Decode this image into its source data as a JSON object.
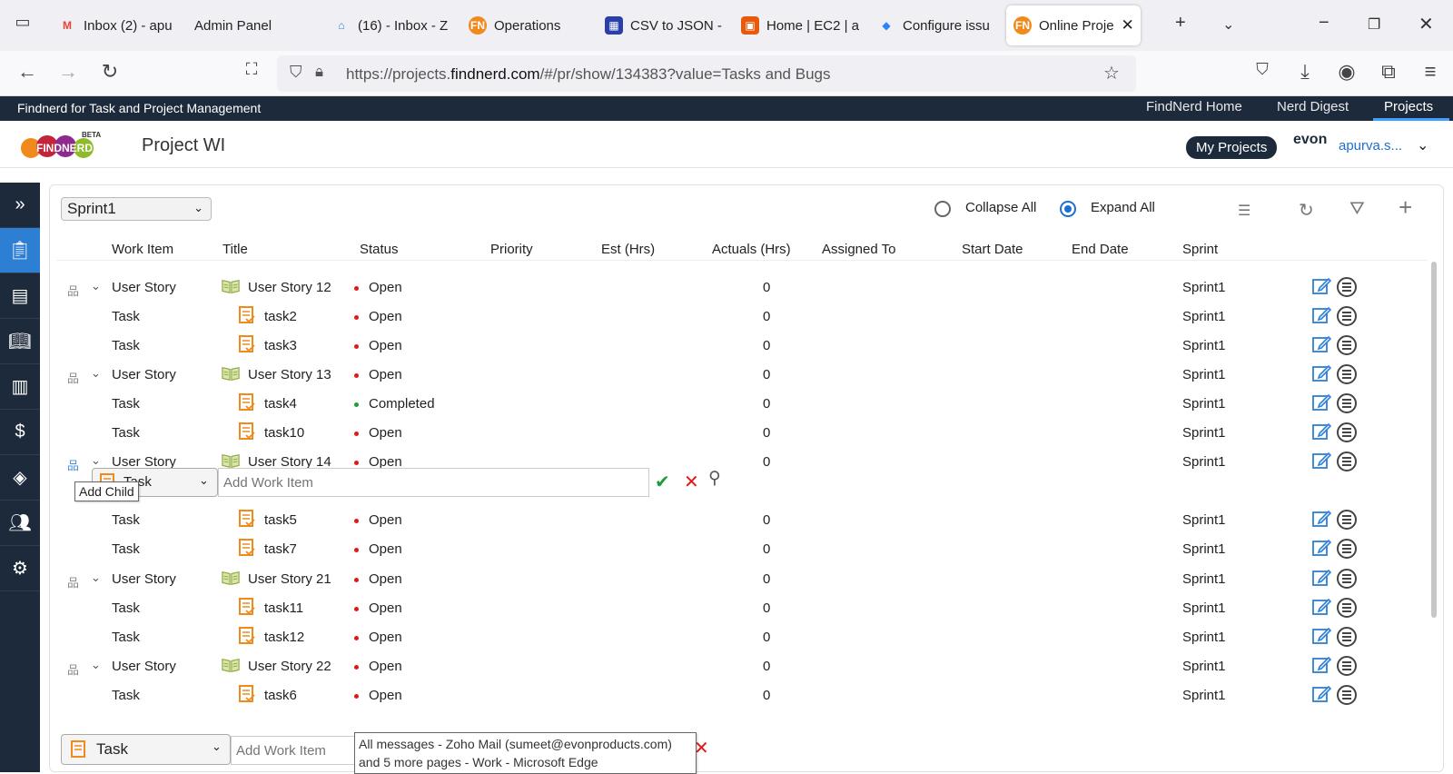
{
  "browser": {
    "tabs": [
      {
        "label": "Inbox (2) - apu",
        "icon": "gmail-icon"
      },
      {
        "label": "Admin Panel",
        "icon": "none"
      },
      {
        "label": "(16) - Inbox - Z",
        "icon": "zoho-icon"
      },
      {
        "label": "Operations",
        "icon": "fn-icon"
      },
      {
        "label": "CSV to JSON -",
        "icon": "csv-icon"
      },
      {
        "label": "Home | EC2 | a",
        "icon": "aws-icon"
      },
      {
        "label": "Configure issu",
        "icon": "jira-icon"
      },
      {
        "label": "Online Proje",
        "icon": "fn-icon",
        "active": true
      }
    ],
    "url_prefix": "https://projects.",
    "url_domain": "findnerd.com",
    "url_suffix": "/#/pr/show/134383?value=Tasks and Bugs"
  },
  "app": {
    "title": "Findnerd for Task and Project Management",
    "nav": [
      "FindNerd Home",
      "Nerd Digest",
      "Projects"
    ],
    "logo_text": "FINDNERD",
    "logo_badge": "BETA",
    "project_title": "Project WI",
    "my_projects": "My Projects",
    "brand": "evon",
    "username": "apurva.s..."
  },
  "toolbar": {
    "sprint": "Sprint1",
    "collapse_all": "Collapse All",
    "expand_all": "Expand All",
    "view_mode": "Expand All"
  },
  "columns": [
    "Work Item",
    "Title",
    "Status",
    "Priority",
    "Est (Hrs)",
    "Actuals (Hrs)",
    "Assigned To",
    "Start Date",
    "End Date",
    "Sprint"
  ],
  "rows": [
    {
      "type": "User Story",
      "title": "User Story 12",
      "status": "Open",
      "actuals": "0",
      "sprint": "Sprint1"
    },
    {
      "type": "Task",
      "title": "task2",
      "status": "Open",
      "actuals": "0",
      "sprint": "Sprint1"
    },
    {
      "type": "Task",
      "title": "task3",
      "status": "Open",
      "actuals": "0",
      "sprint": "Sprint1"
    },
    {
      "type": "User Story",
      "title": "User Story 13",
      "status": "Open",
      "actuals": "0",
      "sprint": "Sprint1"
    },
    {
      "type": "Task",
      "title": "task4",
      "status": "Completed",
      "actuals": "0",
      "sprint": "Sprint1"
    },
    {
      "type": "Task",
      "title": "task10",
      "status": "Open",
      "actuals": "0",
      "sprint": "Sprint1"
    },
    {
      "type": "User Story",
      "title": "User Story 14",
      "status": "Open",
      "actuals": "0",
      "sprint": "Sprint1"
    },
    {
      "type": "Task",
      "title": "task5",
      "status": "Open",
      "actuals": "0",
      "sprint": "Sprint1"
    },
    {
      "type": "Task",
      "title": "task7",
      "status": "Open",
      "actuals": "0",
      "sprint": "Sprint1"
    },
    {
      "type": "User Story",
      "title": "User Story 21",
      "status": "Open",
      "actuals": "0",
      "sprint": "Sprint1"
    },
    {
      "type": "Task",
      "title": "task11",
      "status": "Open",
      "actuals": "0",
      "sprint": "Sprint1"
    },
    {
      "type": "Task",
      "title": "task12",
      "status": "Open",
      "actuals": "0",
      "sprint": "Sprint1"
    },
    {
      "type": "User Story",
      "title": "User Story 22",
      "status": "Open",
      "actuals": "0",
      "sprint": "Sprint1"
    },
    {
      "type": "Task",
      "title": "task6",
      "status": "Open",
      "actuals": "0",
      "sprint": "Sprint1"
    }
  ],
  "inline_add": {
    "type_value": "Task",
    "placeholder": "Add Work Item",
    "tooltip": "Add Child"
  },
  "bottom_add": {
    "type_value": "Task",
    "placeholder": "Add Work Item"
  },
  "os_tooltip": {
    "line1": "All messages - Zoho Mail (sumeet@evonproducts.com)",
    "line2": "and 5 more pages - Work - Microsoft Edge"
  },
  "colors": {
    "status_open": "#e01818",
    "status_completed": "#1f9d3a",
    "sidebar_bg": "#1d2a3b",
    "accent": "#2d7fd3"
  }
}
